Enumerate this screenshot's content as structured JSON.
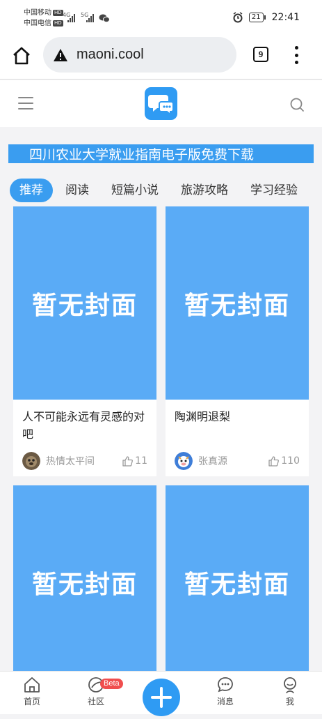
{
  "status_bar": {
    "carrier1": "中国移动",
    "carrier2": "中国电信",
    "hd": "HD",
    "net1": "4G",
    "net2": "5G",
    "battery": "21",
    "time": "22:41"
  },
  "browser": {
    "url": "maoni.cool",
    "tab_count": "9"
  },
  "banner": {
    "text": "四川农业大学就业指南电子版免费下载"
  },
  "tabs": [
    {
      "label": "推荐",
      "active": true
    },
    {
      "label": "阅读"
    },
    {
      "label": "短篇小说"
    },
    {
      "label": "旅游攻略"
    },
    {
      "label": "学习经验"
    }
  ],
  "cards": [
    {
      "cover_text": "暂无封面",
      "title": "人不可能永远有灵感的对吧",
      "author": "热情太平间",
      "likes": "11"
    },
    {
      "cover_text": "暂无封面",
      "title": "陶渊明退梨",
      "author": "张真源",
      "likes": "110"
    },
    {
      "cover_text": "暂无封面"
    },
    {
      "cover_text": "暂无封面"
    }
  ],
  "bottom_nav": {
    "home": "首页",
    "community": "社区",
    "beta": "Beta",
    "messages": "消息",
    "me": "我"
  },
  "colors": {
    "accent": "#2f9bf3",
    "cover": "#5aabf6",
    "badge": "#f04e4e"
  }
}
